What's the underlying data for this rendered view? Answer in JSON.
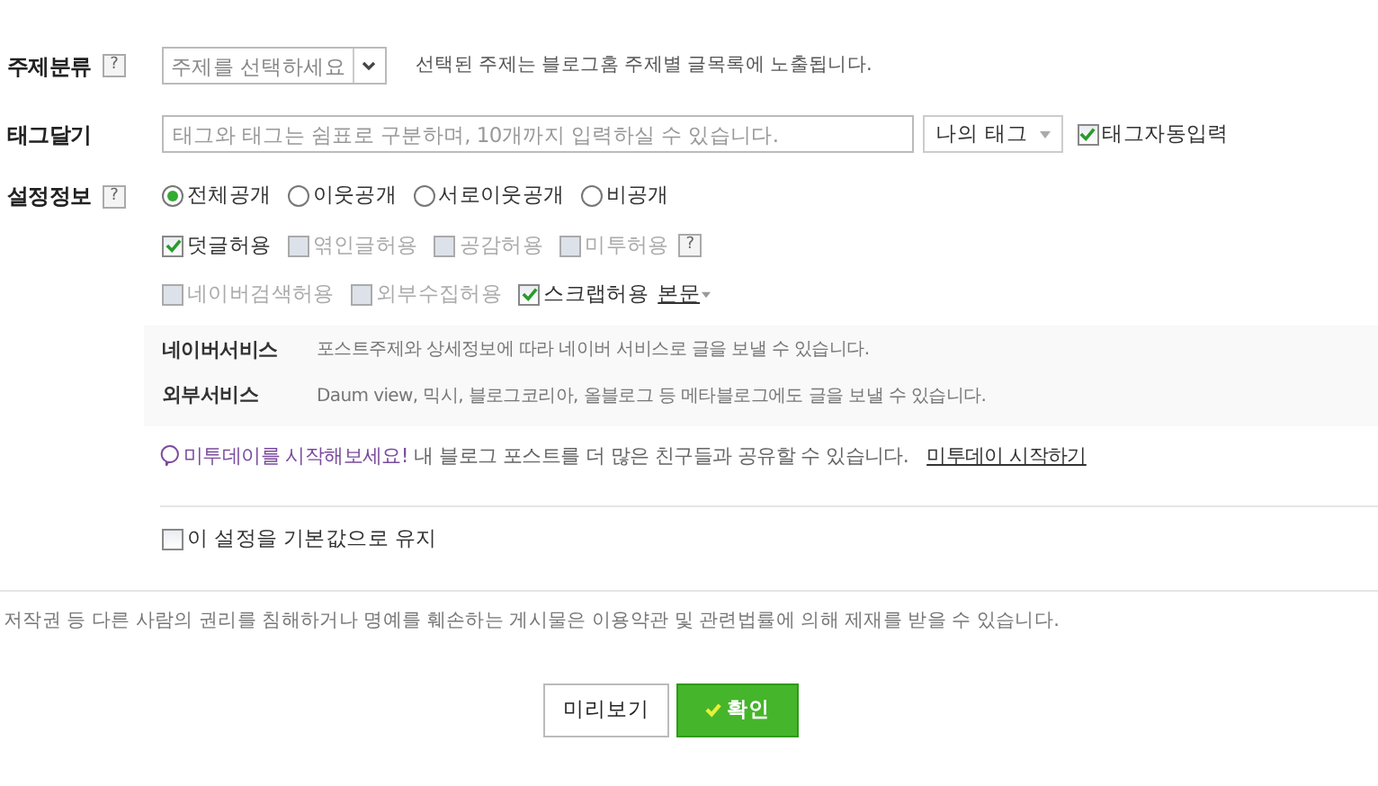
{
  "category": {
    "label": "주제분류",
    "help": "?",
    "select": {
      "value": "주제를 선택하세요"
    },
    "hint": "선택된 주제는 블로그홈 주제별 글목록에 노출됩니다."
  },
  "tags": {
    "label": "태그달기",
    "placeholder": "태그와 태그는 쉼표로 구분하며, 10개까지 입력하실 수 있습니다.",
    "my_tags": "나의 태그",
    "auto": {
      "label": "태그자동입력",
      "checked": true
    }
  },
  "settings": {
    "label": "설정정보",
    "help": "?",
    "visibility": [
      {
        "label": "전체공개",
        "selected": true
      },
      {
        "label": "이웃공개",
        "selected": false
      },
      {
        "label": "서로이웃공개",
        "selected": false
      },
      {
        "label": "비공개",
        "selected": false
      }
    ],
    "permission_rows": [
      [
        {
          "label": "덧글허용",
          "checked": true,
          "disabled": false
        },
        {
          "label": "엮인글허용",
          "checked": false,
          "disabled": true
        },
        {
          "label": "공감허용",
          "checked": false,
          "disabled": true
        },
        {
          "label": "미투허용",
          "checked": false,
          "disabled": true,
          "help": "?"
        }
      ],
      [
        {
          "label": "네이버검색허용",
          "checked": false,
          "disabled": true
        },
        {
          "label": "외부수집허용",
          "checked": false,
          "disabled": true
        },
        {
          "label": "스크랩허용",
          "checked": true,
          "disabled": false,
          "option": "본문"
        }
      ]
    ],
    "services": [
      {
        "name": "네이버서비스",
        "text": "포스트주제와 상세정보에 따라 네이버 서비스로 글을 보낼 수 있습니다."
      },
      {
        "name": "외부서비스",
        "text": "Daum view, 믹시, 블로그코리아, 올블로그 등 메타블로그에도 글을 보낼 수 있습니다."
      }
    ],
    "me2day": {
      "highlight": "미투데이를 시작해보세요!",
      "text": " 내 블로그 포스트를 더 많은 친구들과 공유할 수 있습니다.",
      "link": "미투데이 시작하기"
    },
    "keep_default": {
      "label": "이 설정을 기본값으로 유지",
      "checked": false
    }
  },
  "notice": "저작권 등 다른 사람의 권리를 침해하거나 명예를 훼손하는 게시물은 이용약관 및 관련법률에 의해 제재를 받을 수 있습니다.",
  "buttons": [
    {
      "label": "미리보기",
      "kind": "secondary"
    },
    {
      "label": "확인",
      "kind": "primary"
    }
  ]
}
